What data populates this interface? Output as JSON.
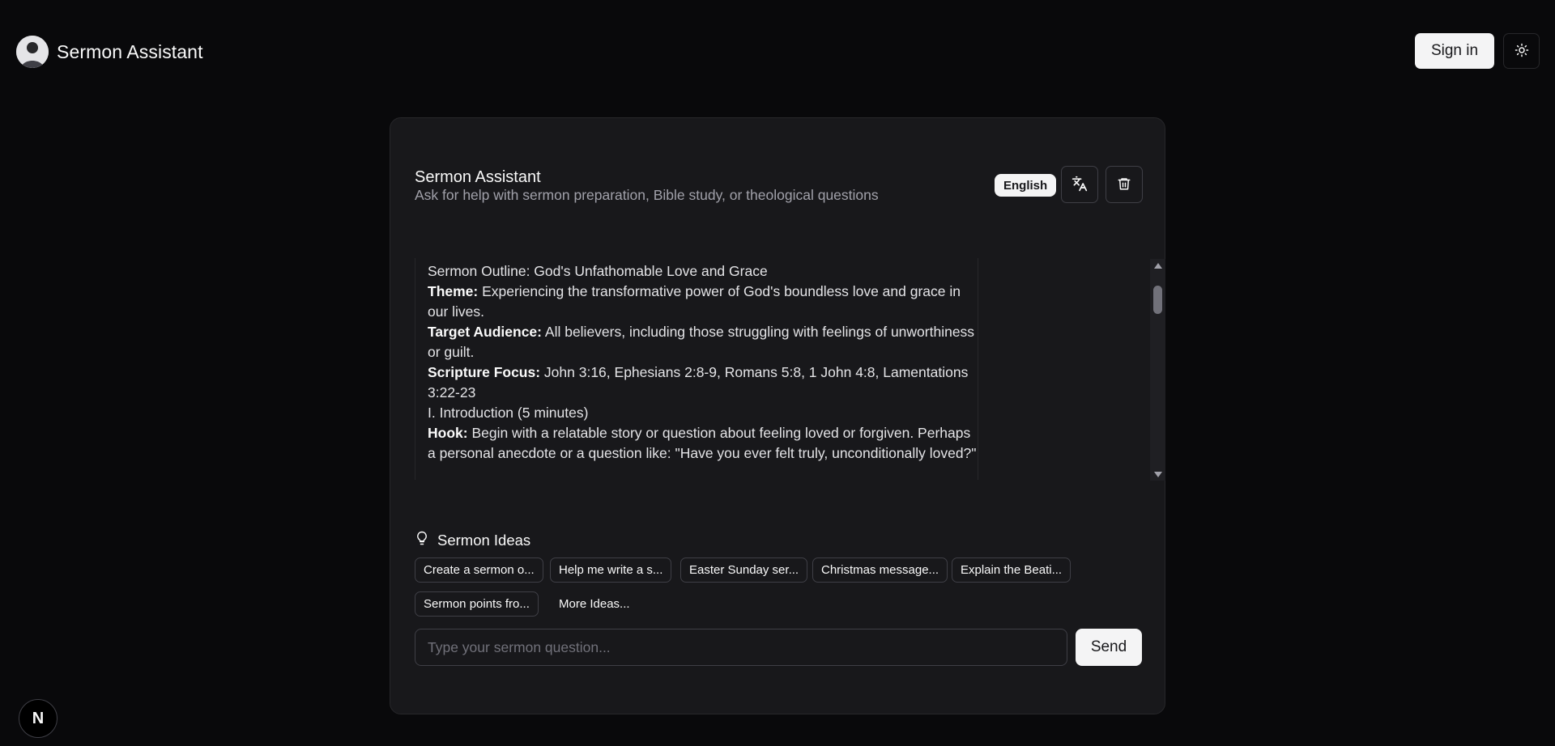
{
  "header": {
    "app_title": "Sermon Assistant",
    "avatar_icon": "user-avatar",
    "signin_label": "Sign in",
    "theme_icon": "sun-icon"
  },
  "card": {
    "title": "Sermon Assistant",
    "subtitle": "Ask for help with sermon preparation, Bible study, or theological questions",
    "language_badge": "English",
    "translate_icon": "translate-icon",
    "delete_icon": "trash-icon"
  },
  "message": {
    "heading": "Sermon Outline: God's Unfathomable Love and Grace",
    "theme_label": "Theme:",
    "theme_text": " Experiencing the transformative power of God's boundless love and grace in our lives.",
    "audience_label": "Target Audience:",
    "audience_text": " All believers, including those struggling with feelings of unworthiness or guilt.",
    "scripture_label": "Scripture Focus:",
    "scripture_text": " John 3:16, Ephesians 2:8-9, Romans 5:8, 1 John 4:8, Lamentations 3:22-23",
    "section_intro": "I. Introduction (5 minutes)",
    "hook_label": "Hook:",
    "hook_text": " Begin with a relatable story or question about feeling loved or forgiven. Perhaps a personal anecdote or a question like: \"Have you ever felt truly, unconditionally loved?\""
  },
  "ideas": {
    "title": "Sermon Ideas",
    "icon": "lightbulb-icon",
    "chips": [
      "Create a sermon o...",
      "Help me write a s...",
      "Easter Sunday ser...",
      "Christmas message...",
      "Explain the Beati...",
      "Sermon points fro..."
    ],
    "more_label": "More Ideas..."
  },
  "input": {
    "placeholder": "Type your sermon question...",
    "value": "",
    "send_label": "Send"
  },
  "footer": {
    "badge_letter": "N"
  },
  "colors": {
    "background": "#09090b",
    "card": "#18181b",
    "border": "#27272a",
    "primary_button": "#f4f4f5",
    "muted_text": "#a1a1aa"
  }
}
